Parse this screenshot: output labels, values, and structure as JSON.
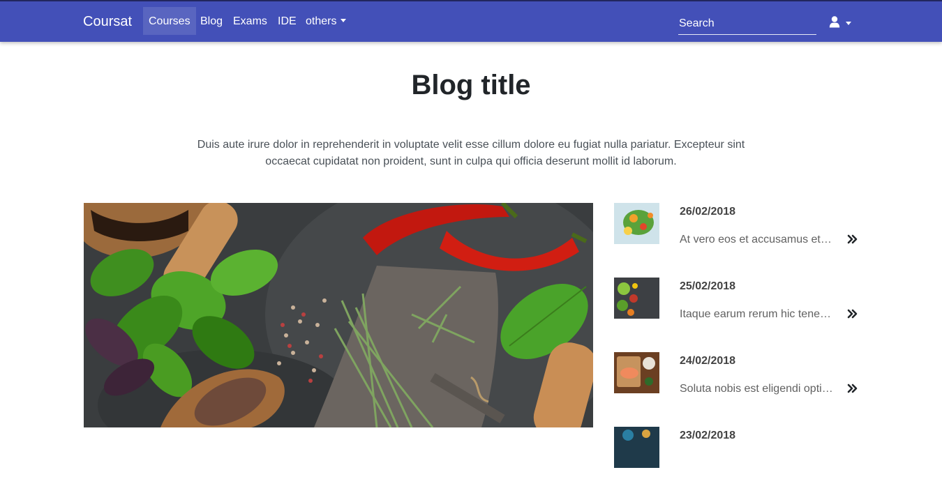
{
  "navbar": {
    "brand": "Coursat",
    "items": [
      {
        "label": "Courses",
        "active": true
      },
      {
        "label": "Blog"
      },
      {
        "label": "Exams"
      },
      {
        "label": "IDE"
      },
      {
        "label": "others"
      }
    ],
    "search_placeholder": "Search",
    "user_icon": "user-icon",
    "color": "#4350b8"
  },
  "main": {
    "title": "Blog title",
    "lead": "Duis aute irure dolor in reprehenderit in voluptate velit esse cillum dolore eu fugiat nulla pariatur. Excepteur sint occaecat cupidatat non proident, sunt in culpa qui officia deserunt mollit id laborum.",
    "hero_image": "herbs-and-spices-photo"
  },
  "sidebar": {
    "posts": [
      {
        "date": "26/02/2018",
        "excerpt": "At vero eos et accusamus et iusto odio dignissimos",
        "thumb": "salad-photo"
      },
      {
        "date": "25/02/2018",
        "excerpt": "Itaque earum rerum hic tenetur a sapiente",
        "thumb": "vegetables-photo"
      },
      {
        "date": "24/02/2018",
        "excerpt": "Soluta nobis est eligendi optio cumque nihil",
        "thumb": "fish-photo"
      },
      {
        "date": "23/02/2018",
        "excerpt": "",
        "thumb": "dish-photo"
      }
    ],
    "arrow_icon": "double-chevron-right-icon"
  }
}
